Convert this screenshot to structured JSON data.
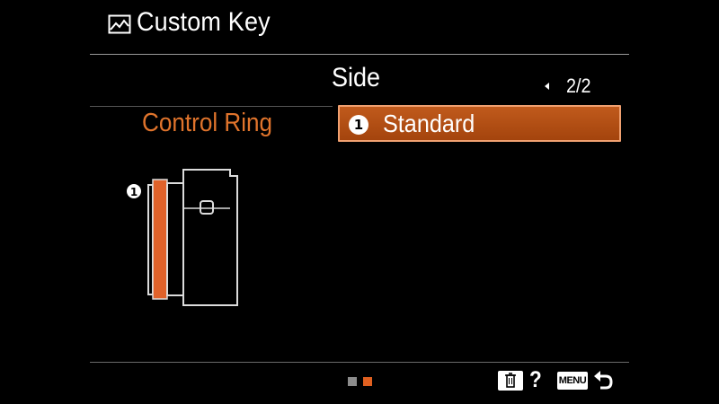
{
  "header": {
    "title": "Custom Key",
    "title_icon": "custom-key-icon"
  },
  "tab": {
    "label": "Side",
    "page": "2/2",
    "nav_icon": "left-arrow-icon"
  },
  "setting": {
    "label": "Control Ring",
    "number": "1",
    "value": "Standard"
  },
  "diagram": {
    "marker": "1",
    "icon": "camera-side-view-icon"
  },
  "footer": {
    "page_dots": 2,
    "active_dot": 2,
    "delete_icon": "trash-icon",
    "help_label": "?",
    "menu_label": "MENU",
    "back_icon": "return-arrow-icon"
  },
  "colors": {
    "accent": "#e0742c",
    "highlight": "#b04e14",
    "inactive_dot": "#8c8c8c",
    "active_dot": "#e06020"
  }
}
